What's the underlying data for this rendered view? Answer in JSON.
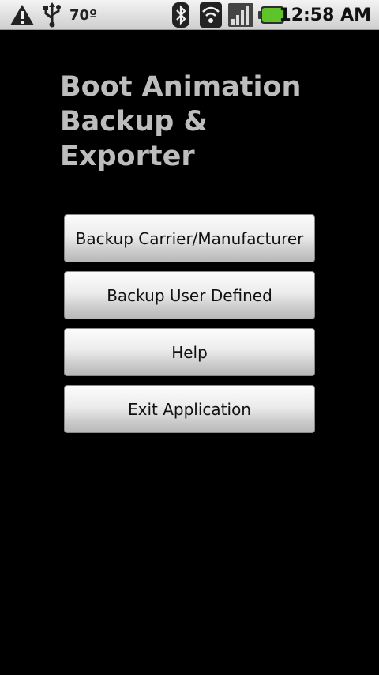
{
  "status_bar": {
    "temperature": "70º",
    "time": "12:58 AM",
    "icons": [
      "warning-icon",
      "usb-icon",
      "bluetooth-icon",
      "wifi-icon",
      "signal-icon",
      "battery-icon"
    ],
    "battery_color": "#5fc32a"
  },
  "title": {
    "line1": "Boot Animation",
    "line2": "Backup &",
    "line3": "Exporter"
  },
  "buttons": [
    {
      "label": "Backup Carrier/Manufacturer"
    },
    {
      "label": "Backup User Defined"
    },
    {
      "label": "Help"
    },
    {
      "label": "Exit Application"
    }
  ]
}
